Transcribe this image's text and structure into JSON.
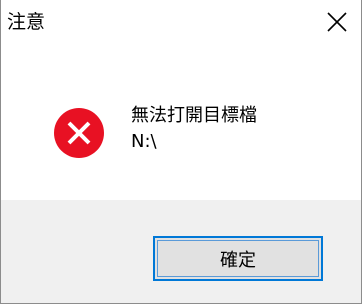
{
  "dialog": {
    "title": "注意",
    "close_icon": "close-icon",
    "icon": "error-icon",
    "message_line1": "無法打開目標檔",
    "message_line2": "N:\\",
    "ok_label": "確定"
  },
  "colors": {
    "error_red": "#e81123",
    "focus_border": "#0078d7",
    "button_bg": "#e1e1e1",
    "footer_bg": "#f0f0f0"
  }
}
